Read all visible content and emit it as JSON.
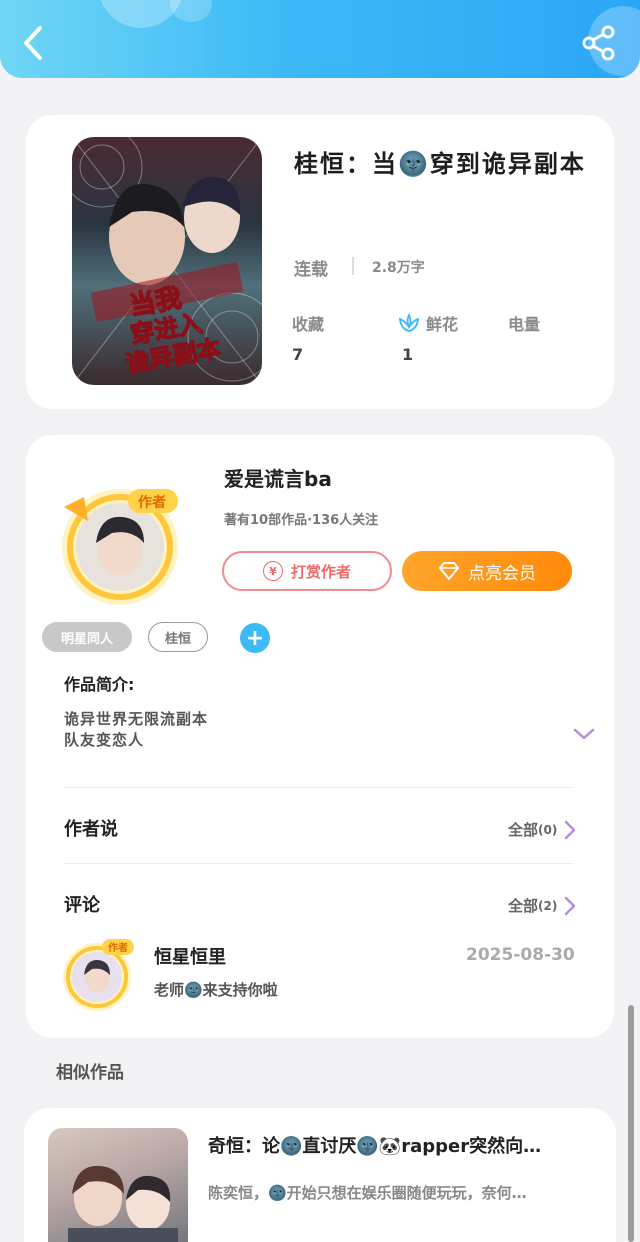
{
  "header": {
    "back_icon": "chevron-left-icon",
    "share_icon": "share-icon"
  },
  "book": {
    "title": "桂恒：当🌚穿到诡异副本",
    "status": "连载",
    "word_count": "2.8万字",
    "stats": [
      {
        "label": "收藏",
        "value": "7"
      },
      {
        "label": "鲜花",
        "value": "1"
      },
      {
        "label": "电量",
        "value": ""
      }
    ]
  },
  "author": {
    "name": "爱是谎言ba",
    "meta": "著有10部作品·136人关注",
    "avatar_badge": "作者",
    "tip_label": "打赏作者",
    "tip_symbol": "¥",
    "vip_label": "点亮会员"
  },
  "tags": [
    "明星同人",
    "桂恒"
  ],
  "add_tag_symbol": "+",
  "intro": {
    "label": "作品简介:",
    "lines": [
      "诡异世界无限流副本",
      "队友变恋人"
    ]
  },
  "author_says": {
    "title": "作者说",
    "all_label": "全部",
    "count": "(0)"
  },
  "comments": {
    "title": "评论",
    "all_label": "全部",
    "count": "(2)",
    "items": [
      {
        "user": "恒星恒里",
        "date": "2025-08-30",
        "text": "老师🌚来支持你啦",
        "avatar_badge": "作者"
      }
    ]
  },
  "similar": {
    "title": "相似作品",
    "items": [
      {
        "title": "奇恒：论🌚直讨厌🌚🐼rapper突然向…",
        "desc": "陈奕恒，🌚开始只想在娱乐圈随便玩玩，奈何…"
      }
    ]
  },
  "cover_text": [
    "当我",
    "穿进入",
    "诡异副本"
  ],
  "colors": {
    "accent_blue": "#3cb9f6",
    "tip_red": "#ef6b6b",
    "vip_orange": "#ff9a1a",
    "expand_purple": "#b58ce0"
  }
}
